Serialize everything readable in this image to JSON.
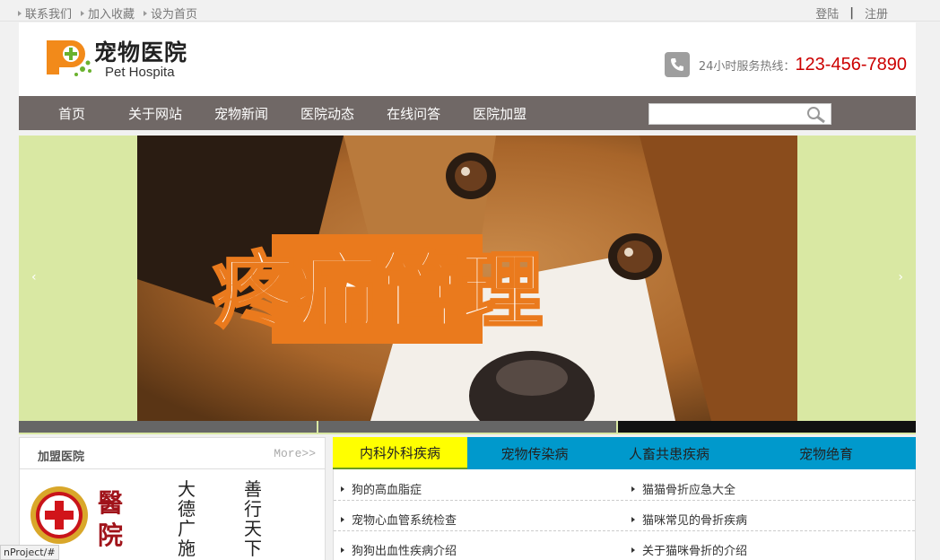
{
  "topbar": {
    "left_links": [
      "联系我们",
      "加入收藏",
      "设为首页"
    ],
    "login": "登陆",
    "separator": "|",
    "register": "注册"
  },
  "header": {
    "brand_cn": "宠物医院",
    "brand_en": "Pet Hospita",
    "hotline_label": "24小时服务热线：",
    "hotline_number": "123-456-7890",
    "logo_icon": "pet-hospital-plus-logo",
    "phone_icon": "phone-icon"
  },
  "nav": {
    "items": [
      "首页",
      "关于网站",
      "宠物新闻",
      "医院动态",
      "在线问答",
      "医院加盟"
    ],
    "search_placeholder": ""
  },
  "banner": {
    "headline": "疼痛管理",
    "prev": "‹",
    "next": "›",
    "slides": 3,
    "active_slide": 3
  },
  "join": {
    "title": "加盟医院",
    "more": "More>>",
    "emblem_text": "醫院",
    "slogan_1": "大德广施",
    "slogan_2": "善行天下"
  },
  "tabs": {
    "items": [
      "内科外科疾病",
      "宠物传染病",
      "人畜共患疾病",
      "宠物绝育"
    ],
    "active": 0
  },
  "news": {
    "left": [
      "狗的高血脂症",
      "宠物心血管系统检查",
      "狗狗出血性疾病介绍"
    ],
    "right": [
      "猫猫骨折应急大全",
      "猫咪常见的骨折疾病",
      "关于猫咪骨折的介绍"
    ]
  },
  "statusbar": {
    "text": "nProject/#"
  },
  "colors": {
    "nav_bg": "#706866",
    "hotline": "#cc0000",
    "tab_bar": "#0099cc",
    "tab_active": "#ffff00",
    "banner_bg": "#d9e8a3"
  }
}
